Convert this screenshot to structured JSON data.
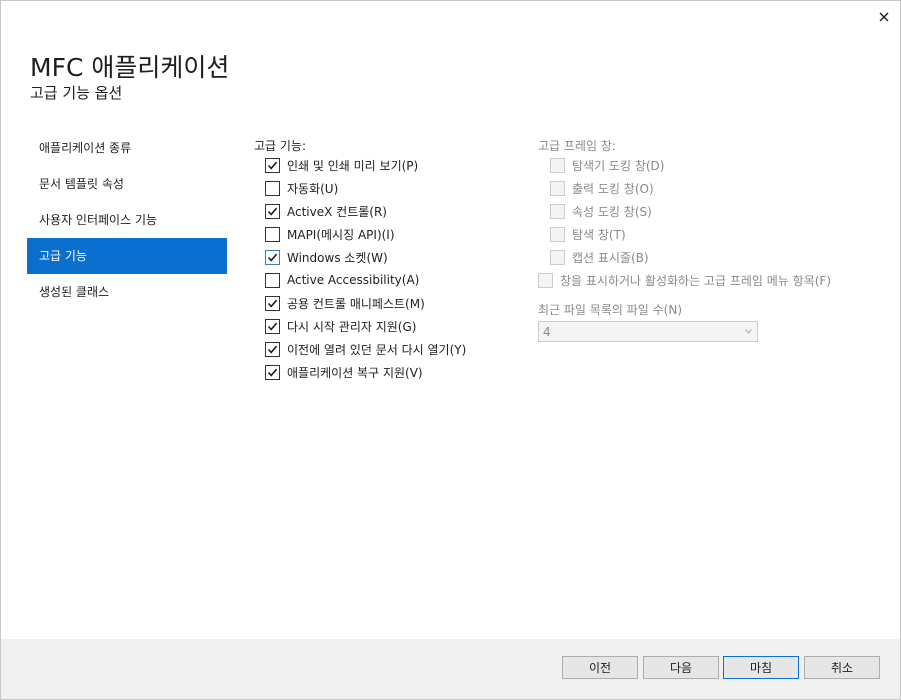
{
  "dialog": {
    "title": "MFC 애플리케이션",
    "subtitle": "고급 기능 옵션",
    "close_icon": "close-icon"
  },
  "nav": {
    "items": [
      {
        "label": "애플리케이션 종류",
        "selected": false
      },
      {
        "label": "문서 템플릿 속성",
        "selected": false
      },
      {
        "label": "사용자 인터페이스 기능",
        "selected": false
      },
      {
        "label": "고급 기능",
        "selected": true
      },
      {
        "label": "생성된 클래스",
        "selected": false
      }
    ],
    "selected_color": "#0a6fce"
  },
  "advanced": {
    "label": "고급 기능:",
    "options": [
      {
        "label": "인쇄 및 인쇄 미리 보기(P)",
        "checked": true
      },
      {
        "label": "자동화(U)",
        "checked": false
      },
      {
        "label": "ActiveX 컨트롤(R)",
        "checked": true
      },
      {
        "label": "MAPI(메시징 API)(I)",
        "checked": false
      },
      {
        "label": "Windows 소켓(W)",
        "checked": true
      },
      {
        "label": "Active Accessibility(A)",
        "checked": false
      },
      {
        "label": "공용 컨트롤 매니페스트(M)",
        "checked": true
      },
      {
        "label": "다시 시작 관리자 지원(G)",
        "checked": true
      },
      {
        "label": "이전에 열려 있던 문서 다시 열기(Y)",
        "checked": true
      },
      {
        "label": "애플리케이션 복구 지원(V)",
        "checked": true
      }
    ]
  },
  "frame_panes": {
    "label": "고급 프레임 창:",
    "options": [
      {
        "label": "탐색기 도킹 창(D)",
        "checked": false
      },
      {
        "label": "출력 도킹 창(O)",
        "checked": false
      },
      {
        "label": "속성 도킹 창(S)",
        "checked": false
      },
      {
        "label": "탐색 창(T)",
        "checked": false
      },
      {
        "label": "캡션 표시줄(B)",
        "checked": false
      }
    ],
    "menu_option": {
      "label": "창을 표시하거나 활성화하는 고급 프레임 메뉴 항목(F)",
      "checked": false
    }
  },
  "mru": {
    "label": "최근 파일 목록의 파일 수(N)",
    "value": "4"
  },
  "footer": {
    "prev_label": "이전",
    "next_label": "다음",
    "finish_label": "마침",
    "cancel_label": "취소"
  }
}
